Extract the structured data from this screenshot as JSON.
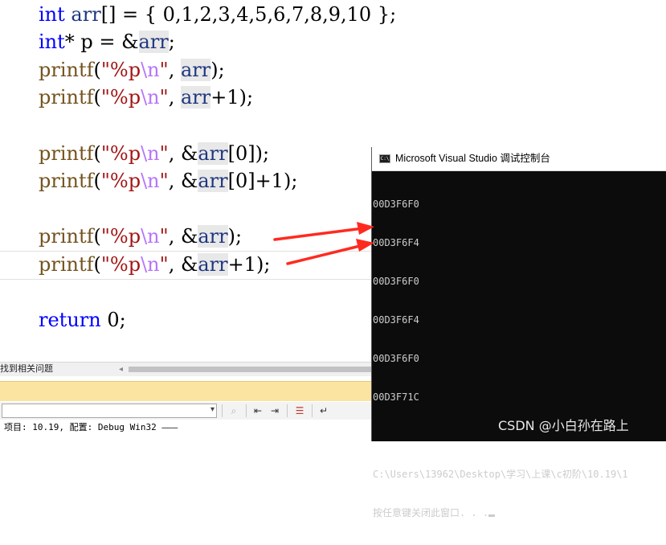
{
  "editor": {
    "lines": [
      {
        "kw": "int",
        "var": "arr",
        "rest": "[] = { 0,1,2,3,4,5,6,7,8,9,10 };"
      },
      {
        "kw": "int",
        "rest1": "* p = &",
        "var": "arr",
        "rest2": ";"
      },
      {
        "fn": "printf",
        "open": "(",
        "str1": "\"%p",
        "esc": "\\n",
        "str2": "\"",
        "mid": ", ",
        "var": "arr",
        "close": ");"
      },
      {
        "fn": "printf",
        "open": "(",
        "str1": "\"%p",
        "esc": "\\n",
        "str2": "\"",
        "mid": ", ",
        "var": "arr",
        "close": "+1);"
      },
      {
        "fn": "printf",
        "open": "(",
        "str1": "\"%p",
        "esc": "\\n",
        "str2": "\"",
        "mid": ", &",
        "var": "arr",
        "close": "[0]);"
      },
      {
        "fn": "printf",
        "open": "(",
        "str1": "\"%p",
        "esc": "\\n",
        "str2": "\"",
        "mid": ", &",
        "var": "arr",
        "close": "[0]+1);"
      },
      {
        "fn": "printf",
        "open": "(",
        "str1": "\"%p",
        "esc": "\\n",
        "str2": "\"",
        "mid": ", &",
        "var": "arr",
        "close": ");"
      },
      {
        "fn": "printf",
        "open": "(",
        "str1": "\"%p",
        "esc": "\\n",
        "str2": "\"",
        "mid": ", &",
        "var": "arr",
        "close": "+1);"
      },
      {
        "kw": "return",
        "rest": " 0;"
      }
    ]
  },
  "panel": {
    "find_related_label": "找到相关问题",
    "status_text": "项目: 10.19, 配置: Debug Win32 ———"
  },
  "console": {
    "icon_label": "C:\\",
    "title": "Microsoft Visual Studio 调试控制台",
    "output": [
      "00D3F6F0",
      "00D3F6F4",
      "00D3F6F0",
      "00D3F6F4",
      "00D3F6F0",
      "00D3F71C",
      "",
      "C:\\Users\\13962\\Desktop\\学习\\上课\\c初阶\\10.19\\1",
      "按任意键关闭此窗口. . ."
    ]
  },
  "watermark": "CSDN @小白孙在路上",
  "colors": {
    "keyword": "#0000ff",
    "function": "#74531f",
    "string": "#a31515",
    "escape": "#b776fb",
    "variable": "#1f377f",
    "arrow": "#ff2a1f",
    "console_bg": "#0c0c0c"
  }
}
